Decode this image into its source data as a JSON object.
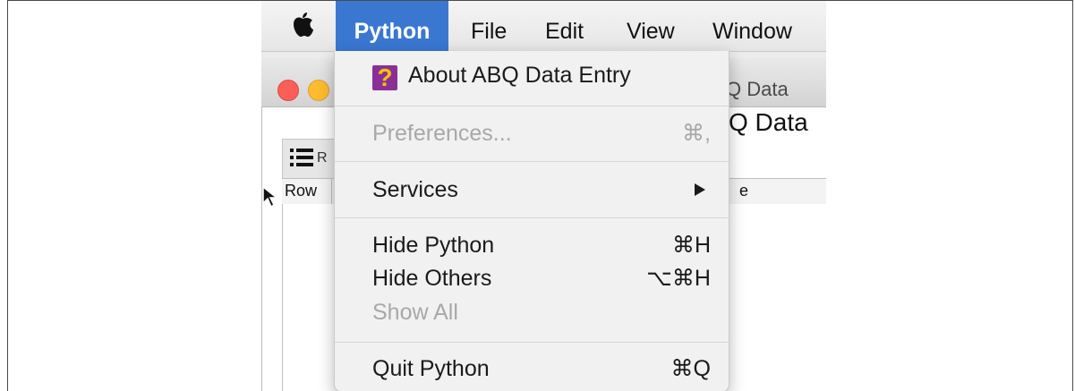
{
  "menubar": {
    "items": [
      "Python",
      "File",
      "Edit",
      "View",
      "Window"
    ]
  },
  "background_window": {
    "title_fragment": "Q Data",
    "heading_fragment": "Q Data",
    "toolbar_fragment": "R",
    "column_header_row": "Row",
    "column_header_fragment": "e"
  },
  "python_menu": {
    "about": {
      "label": "About ABQ Data Entry",
      "icon": "question-mark-icon"
    },
    "preferences": {
      "label": "Preferences...",
      "shortcut": "⌘,"
    },
    "services": {
      "label": "Services"
    },
    "hide_python": {
      "label": "Hide Python",
      "shortcut": "⌘H"
    },
    "hide_others": {
      "label": "Hide Others",
      "shortcut": "⌥⌘H"
    },
    "show_all": {
      "label": "Show All"
    },
    "quit": {
      "label": "Quit Python",
      "shortcut": "⌘Q"
    }
  },
  "colors": {
    "menu_highlight": "#3a77d1",
    "close_button": "#fc5f57",
    "minimize_button": "#fdbc2e"
  }
}
